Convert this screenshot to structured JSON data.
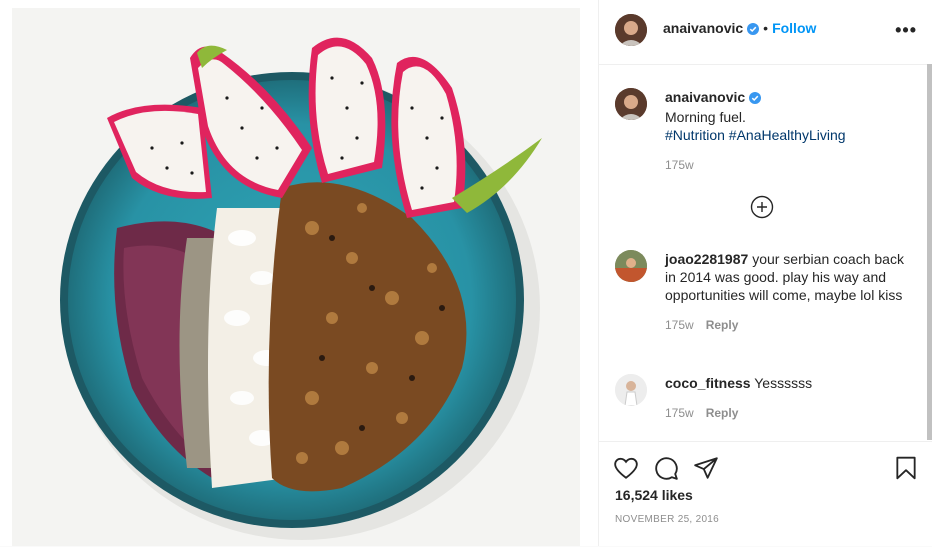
{
  "header": {
    "username": "anaivanovic",
    "follow_label": "Follow",
    "separator": "•",
    "more_label": "•••"
  },
  "caption": {
    "username": "anaivanovic",
    "text": "Morning fuel.",
    "hashtags": "#Nutrition #AnaHealthyLiving",
    "age": "175w"
  },
  "comments": [
    {
      "username": "joao2281987",
      "text": "your serbian coach back in 2014 was good. play his way and opportunities will come, maybe lol kiss",
      "age": "175w",
      "reply_label": "Reply"
    },
    {
      "username": "coco_fitness",
      "text": "Yessssss",
      "age": "175w",
      "reply_label": "Reply"
    }
  ],
  "actions": {
    "likes": "16,524 likes",
    "date": "NOVEMBER 25, 2016"
  },
  "colors": {
    "accent": "#0095f6",
    "verified": "#3897f0",
    "hashtag": "#00376b",
    "muted": "#8e8e8e"
  },
  "icons": [
    "verified-badge-icon",
    "more-options-icon",
    "load-more-comments-icon",
    "heart-icon",
    "comment-icon",
    "share-icon",
    "save-icon"
  ]
}
